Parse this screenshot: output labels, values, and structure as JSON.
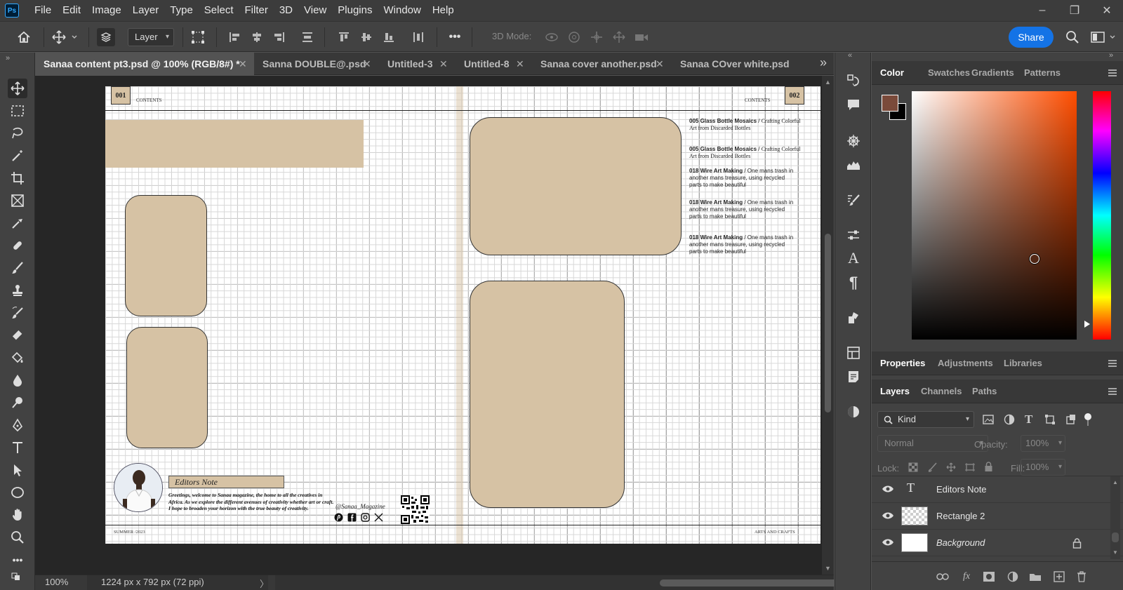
{
  "app": {
    "logo": "Ps"
  },
  "menu": [
    "File",
    "Edit",
    "Image",
    "Layer",
    "Type",
    "Select",
    "Filter",
    "3D",
    "View",
    "Plugins",
    "Window",
    "Help"
  ],
  "window_controls": {
    "minimize": "–",
    "restore": "❐",
    "close": "✕"
  },
  "options_bar": {
    "auto_select_target": "Layer",
    "mode_3d_label": "3D Mode:",
    "more": "•••",
    "share_label": "Share"
  },
  "tabs": [
    {
      "label": "Sanaa content pt3.psd @ 100% (RGB/8#) *",
      "active": true
    },
    {
      "label": "Sanna DOUBLE@.psd",
      "active": false
    },
    {
      "label": "Untitled-3",
      "active": false
    },
    {
      "label": "Untitled-8",
      "active": false
    },
    {
      "label": "Sanaa cover another.psd",
      "active": false
    },
    {
      "label": "Sanaa COver white.psd",
      "active": false
    }
  ],
  "tabs_overflow": "»",
  "document": {
    "page_left_number": "001",
    "page_right_number": "002",
    "left_header": "CONTENTS",
    "right_header": "CONTENTS",
    "footer_left": "SUMMER /2023",
    "footer_right": "ARTS AND CRAFTS",
    "toc": [
      {
        "title": "005 Glass Bottle Mosaics",
        "sep": " / ",
        "desc": "Crafting Colorful Art from Discarded Bottles"
      },
      {
        "title": "005 Glass Bottle Mosaics",
        "sep": " / ",
        "desc": "Crafting Colorful Art from Discarded Bottles"
      },
      {
        "title": "018 Wire Art Making",
        "sep": " / ",
        "desc": "One mans trash in another mans treasure, using recycled parts to make beautiful"
      },
      {
        "title": "018 Wire Art Making",
        "sep": " / ",
        "desc": "One mans trash in another mans treasure, using recycled parts to make beautiful"
      },
      {
        "title": "018 Wire Art Making",
        "sep": " / ",
        "desc": "One mans trash in another mans treasure, using recycled parts to make beautiful"
      }
    ],
    "editors_note_title": "Editors Note",
    "editors_note_body": "Greetings, welcome to Sanaa magazine, the home to all the creatives in Africa. As we explore the different avenues of creativity whether art or craft. I hope to broaden your horizon with the true beauty of creativity.",
    "social_handle": "@Sanaa_Magazine"
  },
  "status": {
    "zoom": "100%",
    "doc_info": "1224 px x 792 px (72 ppi)",
    "arrow": "〉"
  },
  "color_panel": {
    "tabs": [
      "Color",
      "Swatches",
      "Gradients",
      "Patterns"
    ],
    "foreground": "#7a4a3a",
    "background": "#000000"
  },
  "properties_panel": {
    "tabs": [
      "Properties",
      "Adjustments",
      "Libraries"
    ]
  },
  "layers_panel": {
    "tabs": [
      "Layers",
      "Channels",
      "Paths"
    ],
    "filter_kind": "Kind",
    "blend_mode": "Normal",
    "opacity_label": "Opacity:",
    "opacity_value": "100%",
    "lock_label": "Lock:",
    "fill_label": "Fill:",
    "fill_value": "100%",
    "layers": [
      {
        "name": "Editors Note",
        "type": "text"
      },
      {
        "name": "Rectangle 2",
        "type": "transparent"
      },
      {
        "name": "Background",
        "type": "white",
        "locked": true
      }
    ]
  },
  "colors": {
    "accent": "#1473e6",
    "page_beige": "#d6c2a4"
  }
}
